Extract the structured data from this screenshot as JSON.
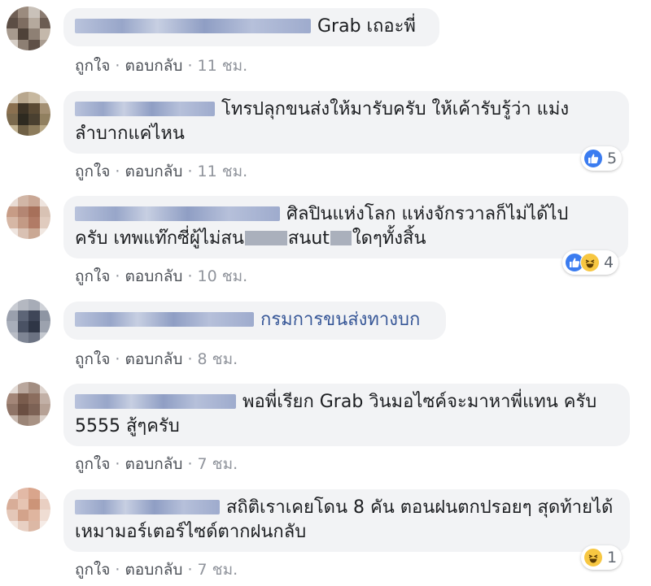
{
  "actions": {
    "like": "ถูกใจ",
    "reply": "ตอบกลับ",
    "sep": "·"
  },
  "comments": [
    {
      "text": "Grab เถอะพี่",
      "time": "11 ชม."
    },
    {
      "text": "โทรปลุกขนส่งให้มารับครับ ให้เค้ารับรู้ว่า แม่งลำบากแค่ไหน",
      "time": "11 ชม.",
      "reaction_count": "5"
    },
    {
      "text1": "ศิลปินแห่งโลก แห่งจักรวาลก็ไม่ได้ไป",
      "text2a": "ครับ เทพแท๊กซี่ผู้ไม่สน",
      "text2b": "สนut",
      "text2c": "ใดๆทั้งสิ้น",
      "time": "10 ชม.",
      "reaction_count": "4"
    },
    {
      "text": "กรมการขนส่งทางบก",
      "time": "8 ชม."
    },
    {
      "text": "พอพี่เรียก Grab วินมอไซค์จะมาหาพี่แทน ครับ 5555 สู้ๆครับ",
      "time": "7 ชม."
    },
    {
      "text": "สถิติเราเคยโดน 8 คัน ตอนฝนตกปรอยๆ สุดท้ายได้เหมามอร์เตอร์ไซด์ตากฝนกลับ",
      "time": "7 ชม.",
      "reaction_count": "1"
    }
  ],
  "colors": {
    "bubble": "#f2f3f5",
    "like": "#3b7cf0",
    "haha": "#f7c742",
    "meta": "#90949c"
  },
  "icons": [
    "like-icon",
    "haha-icon",
    "avatar"
  ]
}
